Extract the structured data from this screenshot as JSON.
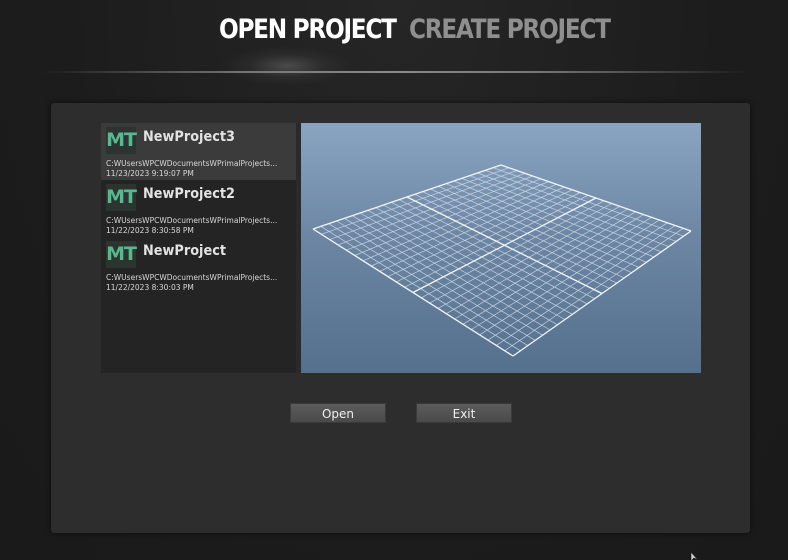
{
  "tabs": {
    "open_label": "OPEN PROJECT",
    "create_label": "CREATE PROJECT",
    "active": "open"
  },
  "projects": [
    {
      "icon_text": "MT",
      "name": "NewProject3",
      "path": "C:WUsersWPCWDocumentsWPrimalProjects...",
      "date": "11/23/2023 9:19:07 PM",
      "selected": true
    },
    {
      "icon_text": "MT",
      "name": "NewProject2",
      "path": "C:WUsersWPCWDocumentsWPrimalProjects...",
      "date": "11/22/2023 8:30:58 PM",
      "selected": false
    },
    {
      "icon_text": "MT",
      "name": "NewProject",
      "path": "C:WUsersWPCWDocumentsWPrimalProjects...",
      "date": "11/22/2023 8:30:03 PM",
      "selected": false
    }
  ],
  "buttons": {
    "open_label": "Open",
    "exit_label": "Exit"
  },
  "colors": {
    "icon_accent": "#58b890",
    "preview_sky_top": "#8aa5c2",
    "preview_sky_bottom": "#55708d",
    "active_tab": "#ffffff",
    "inactive_tab": "#8f8f8f"
  }
}
